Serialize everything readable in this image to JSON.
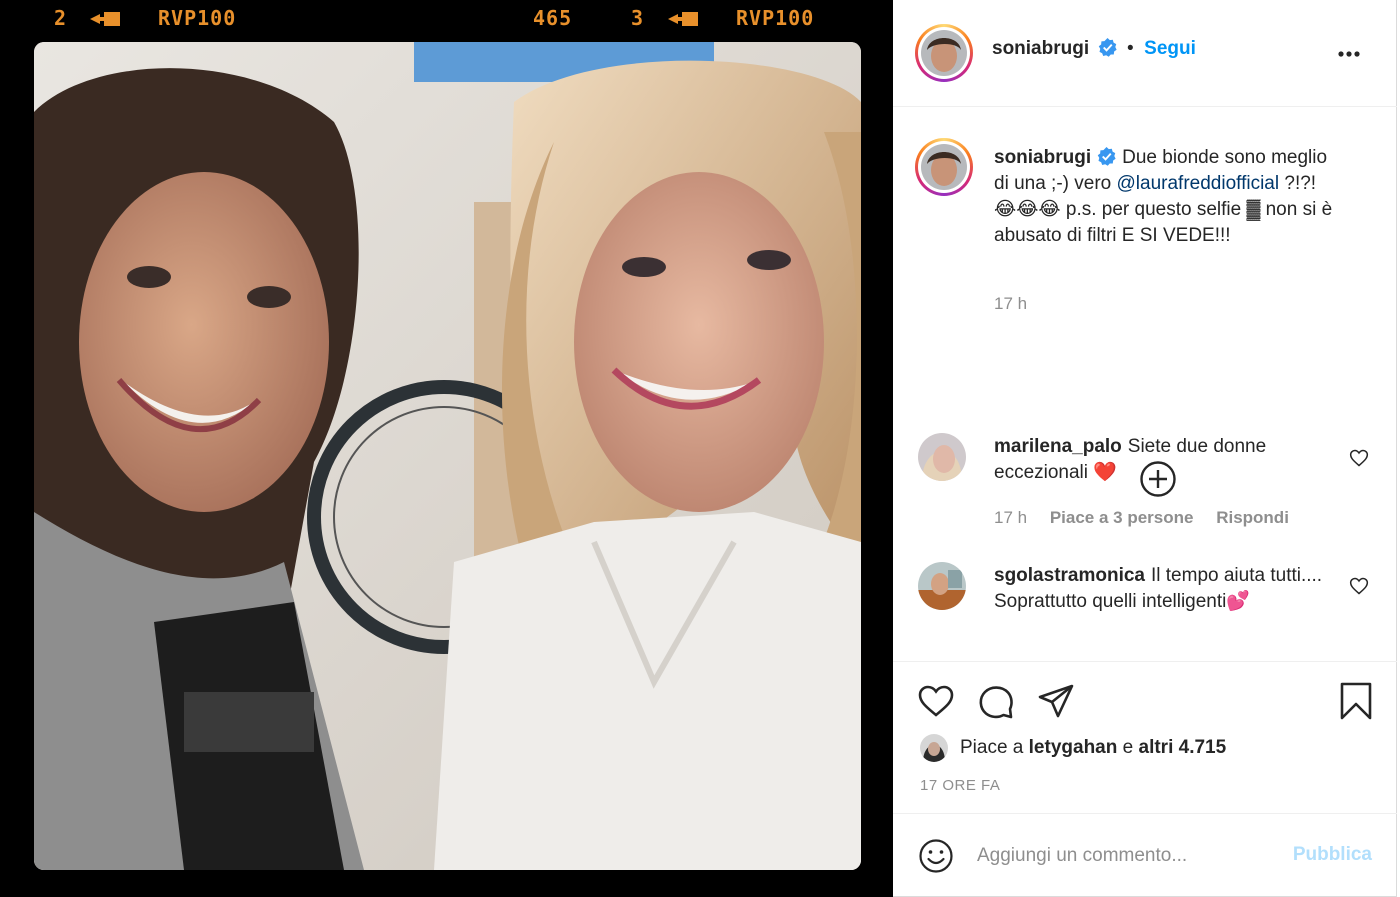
{
  "photo": {
    "film_left_frame": "2",
    "film_left_label": "RVP100",
    "film_counter": "465",
    "film_right_frame": "3",
    "film_right_label": "RVP100",
    "film_color": "#e8902b"
  },
  "header": {
    "username": "soniabrugi",
    "separator": "•",
    "follow_label": "Segui",
    "more_icon": "more-horizontal-icon"
  },
  "caption": {
    "username": "soniabrugi",
    "text_before_mention": "Due bionde sono meglio di una ;-) vero",
    "mention": "@laurafreddiofficial",
    "text_after_mention": "?!?! 😂😂😂 p.s. per questo selfie ▓ non si è abusato di filtri E SI VEDE!!!",
    "time": "17 h"
  },
  "comments": [
    {
      "username": "marilena_palo",
      "text": "Siete due donne eccezionali ❤️",
      "time": "17 h",
      "likes": "Piace a 3 persone",
      "reply": "Rispondi"
    },
    {
      "username": "sgolastramonica",
      "text": "Il tempo aiuta tutti.... Soprattutto quelli intelligenti💕"
    }
  ],
  "actions": {
    "likes_prefix": "Piace a",
    "likes_user": "letygahan",
    "likes_mid": "e",
    "likes_others": "altri 4.715",
    "timestamp": "17 ORE FA"
  },
  "add_comment": {
    "placeholder": "Aggiungi un commento...",
    "publish_label": "Pubblica"
  },
  "colors": {
    "link_blue": "#0095f6",
    "publish_disabled": "#b2dffc",
    "mention": "#00376b",
    "meta_gray": "#8e8e8e"
  }
}
